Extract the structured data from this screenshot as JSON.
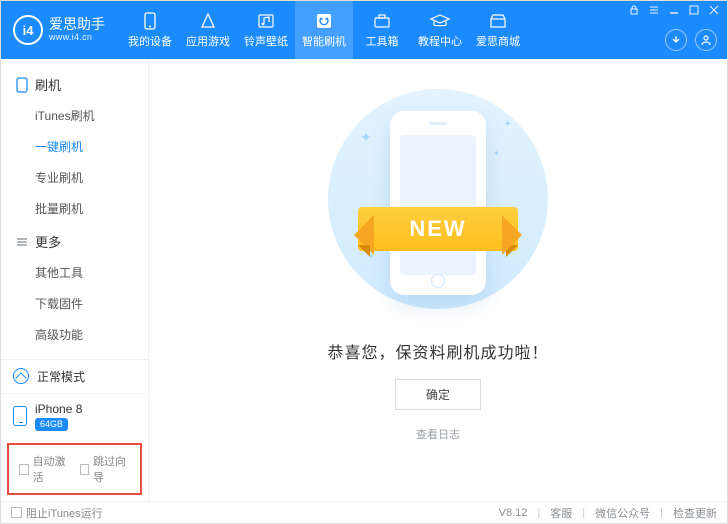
{
  "header": {
    "app_name": "爱思助手",
    "site_url": "www.i4.cn",
    "nav": [
      {
        "label": "我的设备",
        "icon": "device"
      },
      {
        "label": "应用游戏",
        "icon": "apps"
      },
      {
        "label": "铃声壁纸",
        "icon": "media"
      },
      {
        "label": "智能刷机",
        "icon": "flash",
        "active": true
      },
      {
        "label": "工具箱",
        "icon": "tools"
      },
      {
        "label": "教程中心",
        "icon": "edu"
      },
      {
        "label": "爱思商城",
        "icon": "shop"
      }
    ]
  },
  "sidebar": {
    "groups": [
      {
        "title": "刷机",
        "icon": "phone",
        "items": [
          {
            "label": "iTunes刷机"
          },
          {
            "label": "一键刷机",
            "active": true
          },
          {
            "label": "专业刷机"
          },
          {
            "label": "批量刷机"
          }
        ]
      },
      {
        "title": "更多",
        "icon": "more",
        "items": [
          {
            "label": "其他工具"
          },
          {
            "label": "下载固件"
          },
          {
            "label": "高级功能"
          }
        ]
      }
    ],
    "mode_label": "正常模式",
    "device": {
      "name": "iPhone 8",
      "storage": "64GB"
    },
    "checks": {
      "auto_activate": "自动激活",
      "skip_guide": "跳过向导"
    }
  },
  "main": {
    "ribbon": "NEW",
    "success_text": "恭喜您，保资料刷机成功啦！",
    "ok_button": "确定",
    "log_link": "查看日志"
  },
  "statusbar": {
    "block_itunes": "阻止iTunes运行",
    "version": "V8.12",
    "links": [
      "客服",
      "微信公众号",
      "检查更新"
    ]
  }
}
